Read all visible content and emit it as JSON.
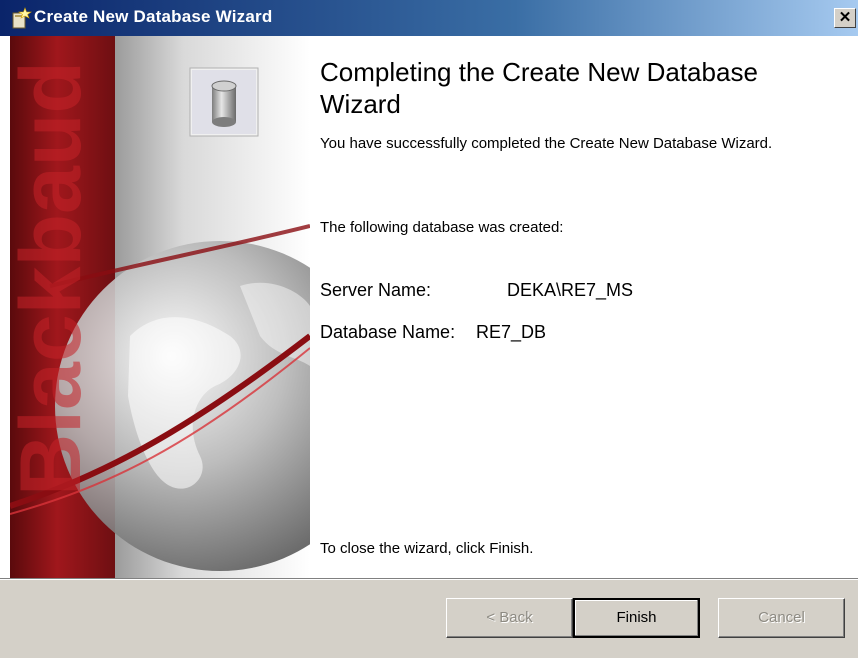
{
  "window": {
    "title": "Create New Database Wizard",
    "close_glyph": "✕"
  },
  "side_panel": {
    "brand_text": "Blackbaud",
    "icon": "database-icon"
  },
  "main": {
    "heading": "Completing the Create New Database Wizard",
    "success_message": "You have successfully completed the Create New Database Wizard.",
    "created_label": "The following database was created:",
    "server_label": "Server Name:",
    "server_value": "DEKA\\RE7_MS",
    "database_label": "Database Name:",
    "database_value": "RE7_DB",
    "close_hint": "To close the wizard, click Finish."
  },
  "buttons": {
    "back": "< Back",
    "finish": "Finish",
    "cancel": "Cancel"
  },
  "colors": {
    "titlebar_start": "#0a246a",
    "titlebar_end": "#a6caf0",
    "brand_red": "#a0171c"
  }
}
